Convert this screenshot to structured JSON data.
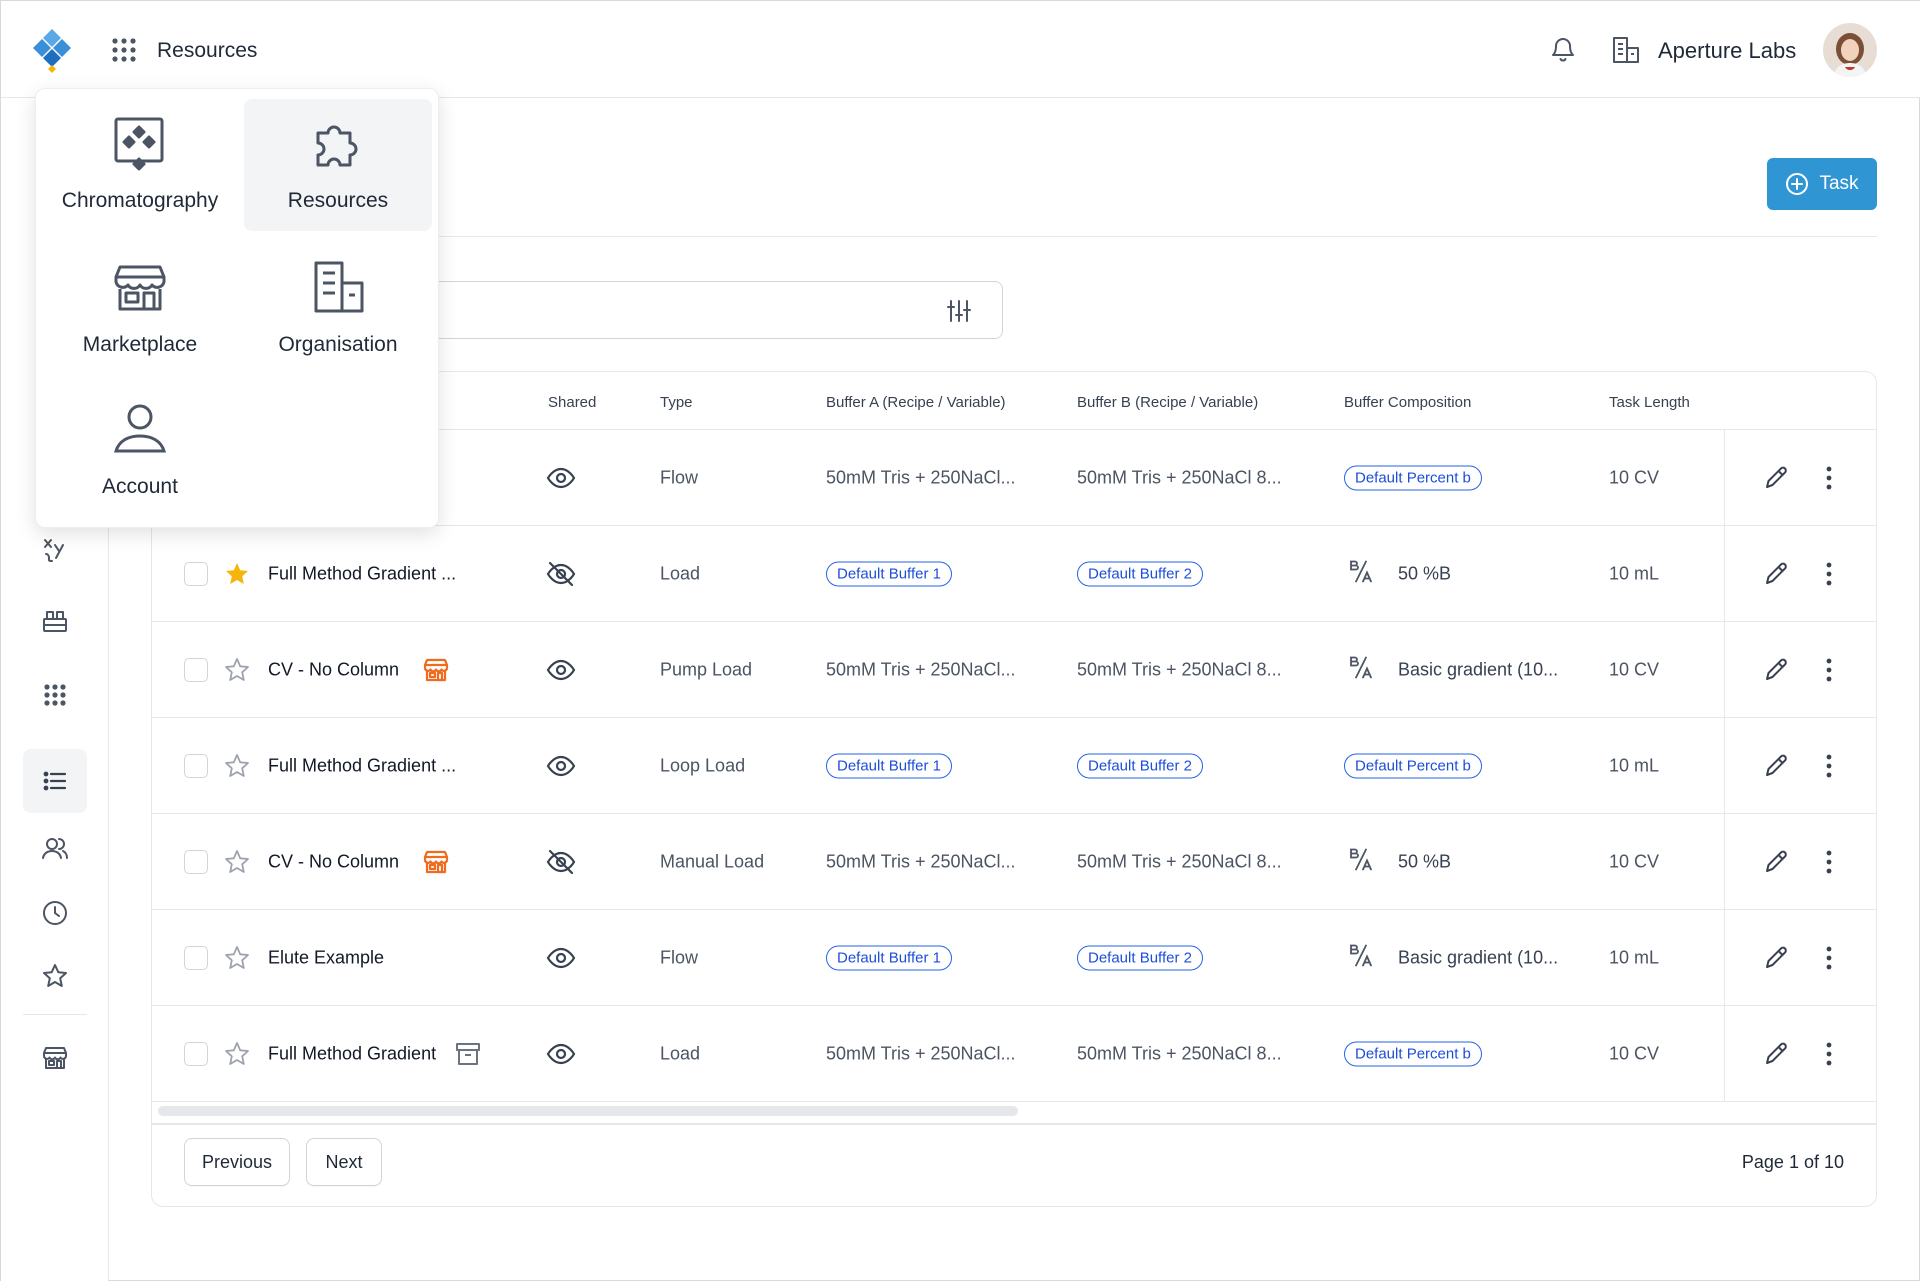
{
  "header": {
    "title": "Resources",
    "org_name": "Aperture Labs"
  },
  "app_menu": {
    "items": [
      {
        "label": "Chromatography",
        "icon": "chromatography-icon"
      },
      {
        "label": "Resources",
        "icon": "puzzle-icon",
        "active": true
      },
      {
        "label": "Marketplace",
        "icon": "store-icon"
      },
      {
        "label": "Organisation",
        "icon": "building-icon"
      },
      {
        "label": "Account",
        "icon": "user-icon"
      }
    ]
  },
  "toolbar": {
    "task_label": "Task"
  },
  "search": {
    "placeholder": ""
  },
  "table": {
    "columns": {
      "shared": "Shared",
      "type": "Type",
      "buffer_a": "Buffer A (Recipe / Variable)",
      "buffer_b": "Buffer B (Recipe / Variable)",
      "composition": "Buffer Composition",
      "task_length": "Task Length"
    },
    "rows": [
      {
        "name": "",
        "starred": false,
        "shared": true,
        "type": "Flow",
        "buffer_a": "50mM Tris + 250NaCl...",
        "buffer_a_pill": false,
        "buffer_b": "50mM Tris + 250NaCl 8...",
        "buffer_b_pill": false,
        "composition": "Default Percent b",
        "composition_pill": true,
        "task_length": "10 CV"
      },
      {
        "name": "Full Method Gradient ...",
        "starred": true,
        "shared": false,
        "type": "Load",
        "buffer_a": "Default Buffer 1",
        "buffer_a_pill": true,
        "buffer_b": "Default Buffer 2",
        "buffer_b_pill": true,
        "composition": "50 %B",
        "composition_pill": false,
        "task_length": "10 mL"
      },
      {
        "name": "CV -  No Column",
        "starred": false,
        "badge": "store",
        "shared": true,
        "type": "Pump  Load",
        "buffer_a": "50mM Tris + 250NaCl...",
        "buffer_a_pill": false,
        "buffer_b": "50mM Tris + 250NaCl 8...",
        "buffer_b_pill": false,
        "composition": "Basic gradient (10...",
        "composition_pill": false,
        "task_length": "10 CV"
      },
      {
        "name": "Full Method Gradient ...",
        "starred": false,
        "shared": true,
        "type": "Loop Load",
        "buffer_a": "Default Buffer 1",
        "buffer_a_pill": true,
        "buffer_b": "Default Buffer 2",
        "buffer_b_pill": true,
        "composition": "Default Percent b",
        "composition_pill": true,
        "task_length": "10 mL"
      },
      {
        "name": "CV -  No Column",
        "starred": false,
        "badge": "store",
        "shared": false,
        "type": "Manual Load",
        "buffer_a": "50mM Tris + 250NaCl...",
        "buffer_a_pill": false,
        "buffer_b": "50mM Tris + 250NaCl 8...",
        "buffer_b_pill": false,
        "composition": "50 %B",
        "composition_pill": false,
        "task_length": "10 CV"
      },
      {
        "name": "Elute Example",
        "starred": false,
        "shared": true,
        "type": "Flow",
        "buffer_a": "Default Buffer 1",
        "buffer_a_pill": true,
        "buffer_b": "Default Buffer 2",
        "buffer_b_pill": true,
        "composition": "Basic gradient (10...",
        "composition_pill": false,
        "task_length": "10 mL"
      },
      {
        "name": "Full Method Gradient",
        "starred": false,
        "badge": "archive",
        "shared": true,
        "type": "Load",
        "buffer_a": "50mM Tris + 250NaCl...",
        "buffer_a_pill": false,
        "buffer_b": "50mM Tris + 250NaCl 8...",
        "buffer_b_pill": false,
        "composition": "Default Percent b",
        "composition_pill": true,
        "task_length": "10 CV"
      }
    ]
  },
  "pagination": {
    "previous": "Previous",
    "next": "Next",
    "info": "Page 1 of 10"
  },
  "colors": {
    "primary": "#2f96d3",
    "pill_blue": "#2563eb",
    "star_filled": "#f5b50a",
    "marketplace_orange": "#ef6c1e"
  }
}
